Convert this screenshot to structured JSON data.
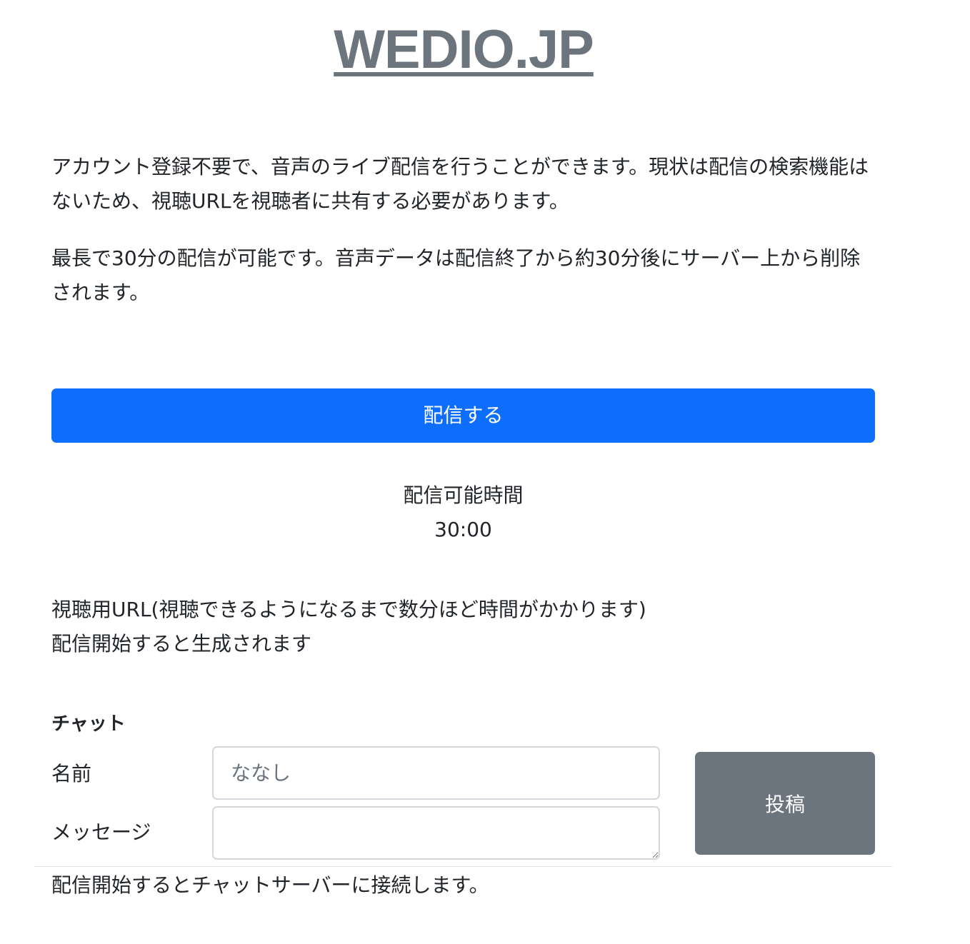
{
  "header": {
    "title": "WEDIO.JP"
  },
  "intro": {
    "paragraph1_line1": "アカウント登録不要で、音声のライブ配信を行うことができます。現状は配信の検索機能は",
    "paragraph1_line2": "ないため、視聴URLを視聴者に共有する必要があります。",
    "paragraph2_line1": "最長で30分の配信が可能です。音声データは配信終了から約30分後にサーバー上から削除",
    "paragraph2_line2": "されます。"
  },
  "broadcast": {
    "button_label": "配信する",
    "time_label": "配信可能時間",
    "time_value": "30:00"
  },
  "viewer_url": {
    "label": "視聴用URL(視聴できるようになるまで数分ほど時間がかかります)",
    "status": "配信開始すると生成されます"
  },
  "chat": {
    "heading": "チャット",
    "name_label": "名前",
    "name_placeholder": "ななし",
    "message_label": "メッセージ",
    "post_button_label": "投稿",
    "status_text": "配信開始するとチャットサーバーに接続します。"
  },
  "colors": {
    "primary": "#0d6efd",
    "secondary": "#6c757d",
    "text": "#212529"
  }
}
